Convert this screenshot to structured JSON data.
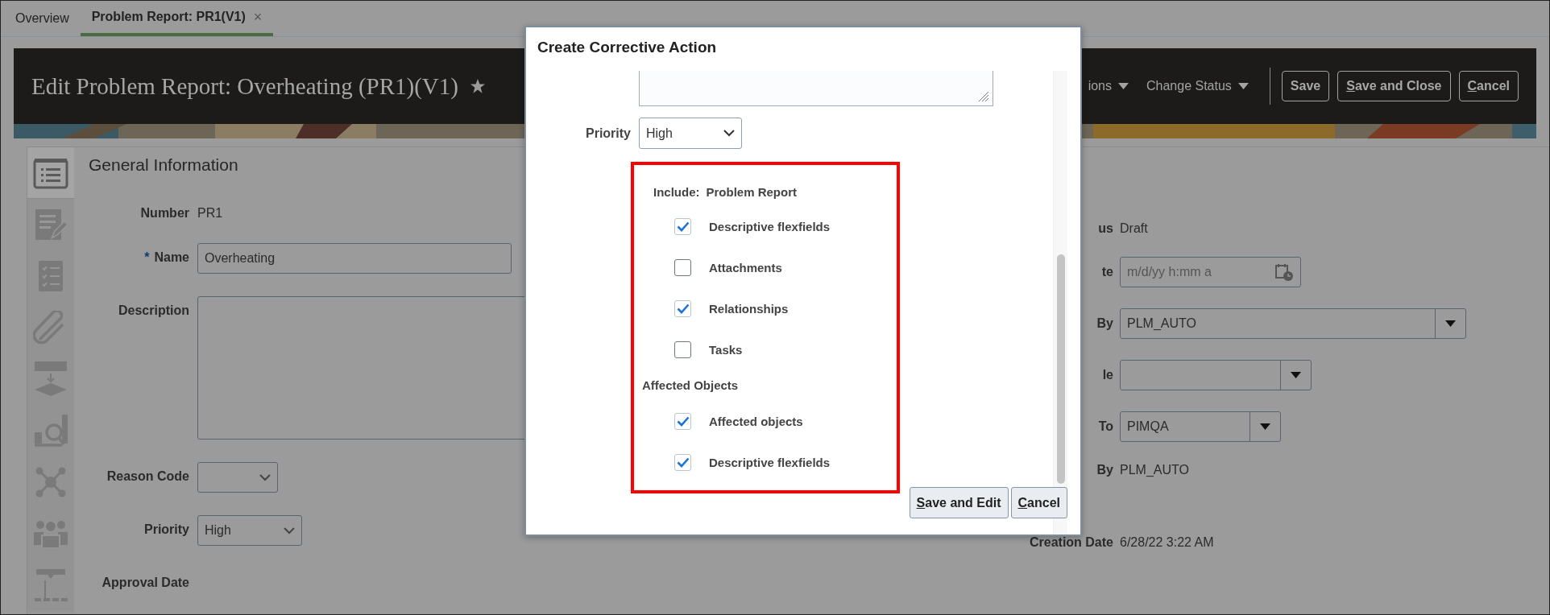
{
  "tabs": [
    {
      "label": "Overview",
      "selected": false,
      "closable": false
    },
    {
      "label": "Problem Report: PR1(V1)",
      "selected": true,
      "closable": true,
      "close_glyph": "×"
    }
  ],
  "header": {
    "title": "Edit Problem Report: Overheating (PR1)(V1)",
    "menus": [
      {
        "label": "ions"
      },
      {
        "label": "Change Status"
      }
    ],
    "buttons": [
      {
        "label": "Save",
        "mnemonic": false
      },
      {
        "label": "Save and Close",
        "mnemonic": true
      },
      {
        "label": "Cancel",
        "mnemonic": true
      }
    ]
  },
  "nav_icons": [
    {
      "kind": "list",
      "selected": true
    },
    {
      "kind": "edit",
      "selected": false
    },
    {
      "kind": "checklist",
      "selected": false
    },
    {
      "kind": "clip",
      "selected": false
    },
    {
      "kind": "flow",
      "selected": false
    },
    {
      "kind": "chart",
      "selected": false
    },
    {
      "kind": "network",
      "selected": false
    },
    {
      "kind": "people",
      "selected": false
    },
    {
      "kind": "hierarchy",
      "selected": false
    }
  ],
  "section_title": "General Information",
  "required_mark": "*",
  "left_fields": [
    {
      "label": "Number",
      "required": false,
      "kind": "text",
      "value": "PR1"
    },
    {
      "label": "Name",
      "required": true,
      "kind": "input",
      "value": "Overheating"
    },
    {
      "label": "Description",
      "required": false,
      "kind": "textarea"
    },
    {
      "label": "Reason Code",
      "required": false,
      "kind": "select"
    },
    {
      "label": "Priority",
      "required": false,
      "kind": "select",
      "value": "High"
    },
    {
      "label": "Approval Date",
      "required": false,
      "kind": "none"
    }
  ],
  "right_fields": [
    {
      "label": "us",
      "kind": "text",
      "value": "Draft"
    },
    {
      "label": "te",
      "kind": "date",
      "placeholder": "m/d/yy h:mm a"
    },
    {
      "label": "By",
      "kind": "combo",
      "value": "PLM_AUTO"
    },
    {
      "label": "le",
      "kind": "combo"
    },
    {
      "label": "To",
      "kind": "combo",
      "value": "PIMQA"
    },
    {
      "label": "By",
      "kind": "text",
      "value": "PLM_AUTO"
    },
    {
      "label": "Creation Date",
      "kind": "text",
      "value": "6/28/22 3:22 AM"
    }
  ],
  "dialog": {
    "title": "Create Corrective Action",
    "priority": {
      "label": "Priority",
      "value": "High"
    },
    "highlighted": true,
    "include": {
      "label": "Include:",
      "value": "Problem Report"
    },
    "include_options": [
      {
        "label": "Descriptive flexfields",
        "checked": true
      },
      {
        "label": "Attachments",
        "checked": false
      },
      {
        "label": "Relationships",
        "checked": true
      },
      {
        "label": "Tasks",
        "checked": false
      }
    ],
    "affected_heading": "Affected Objects",
    "affected_options": [
      {
        "label": "Affected objects",
        "checked": true
      },
      {
        "label": "Descriptive flexfields",
        "checked": true
      }
    ],
    "buttons": [
      {
        "label": "Save and Edit",
        "mnemonic": true
      },
      {
        "label": "Cancel",
        "mnemonic": true
      }
    ]
  }
}
